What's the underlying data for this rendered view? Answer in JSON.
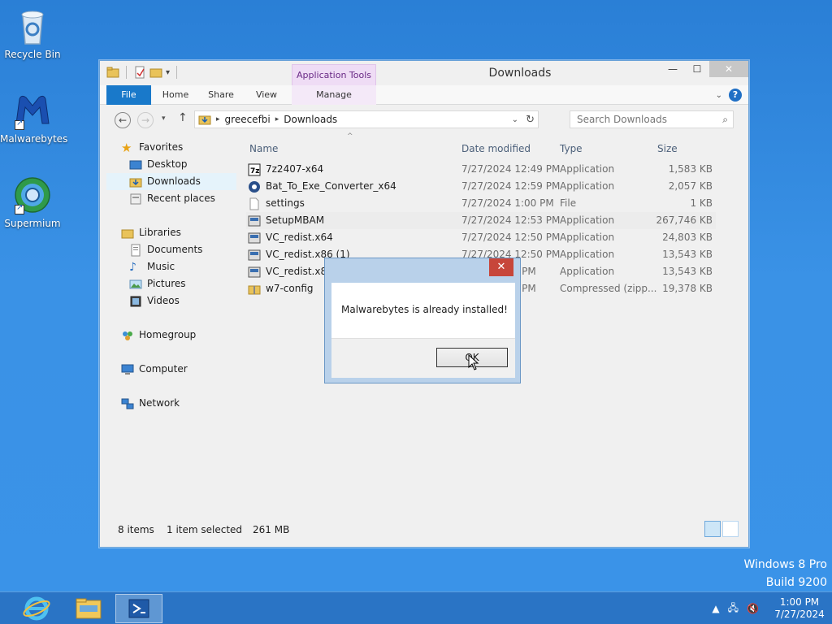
{
  "desktop": {
    "icons": [
      {
        "label": "Recycle Bin"
      },
      {
        "label": "Malwarebytes"
      },
      {
        "label": "Supermium"
      }
    ],
    "watermark": {
      "line1": "Windows 8 Pro",
      "line2": "Build 9200"
    }
  },
  "explorer": {
    "title": "Downloads",
    "context_tab_header": "Application Tools",
    "ribbon_tabs": {
      "file": "File",
      "home": "Home",
      "share": "Share",
      "view": "View",
      "manage": "Manage"
    },
    "address": {
      "crumbs": [
        "greecefbi",
        "Downloads"
      ]
    },
    "search_placeholder": "Search Downloads",
    "nav": {
      "favorites": "Favorites",
      "desktop": "Desktop",
      "downloads": "Downloads",
      "recent": "Recent places",
      "libraries": "Libraries",
      "documents": "Documents",
      "music": "Music",
      "pictures": "Pictures",
      "videos": "Videos",
      "homegroup": "Homegroup",
      "computer": "Computer",
      "network": "Network"
    },
    "columns": {
      "name": "Name",
      "date": "Date modified",
      "type": "Type",
      "size": "Size"
    },
    "files": [
      {
        "name": "7z2407-x64",
        "date": "7/27/2024 12:49 PM",
        "type": "Application",
        "size": "1,583 KB"
      },
      {
        "name": "Bat_To_Exe_Converter_x64",
        "date": "7/27/2024 12:59 PM",
        "type": "Application",
        "size": "2,057 KB"
      },
      {
        "name": "settings",
        "date": "7/27/2024 1:00 PM",
        "type": "File",
        "size": "1 KB"
      },
      {
        "name": "SetupMBAM",
        "date": "7/27/2024 12:53 PM",
        "type": "Application",
        "size": "267,746 KB"
      },
      {
        "name": "VC_redist.x64",
        "date": "7/27/2024 12:50 PM",
        "type": "Application",
        "size": "24,803 KB"
      },
      {
        "name": "VC_redist.x86 (1)",
        "date": "7/27/2024 12:50 PM",
        "type": "Application",
        "size": "13,543 KB"
      },
      {
        "name": "VC_redist.x86",
        "date": "50 PM",
        "type": "Application",
        "size": "13,543 KB"
      },
      {
        "name": "w7-config",
        "date": "50 PM",
        "type": "Compressed (zipp...",
        "size": "19,378 KB"
      }
    ],
    "status": {
      "items": "8 items",
      "selected": "1 item selected",
      "size": "261 MB"
    }
  },
  "dialog": {
    "message": "Malwarebytes is already installed!",
    "ok_label": "OK",
    "close_glyph": "✕"
  },
  "taskbar": {
    "clock_time": "1:00 PM",
    "clock_date": "7/27/2024"
  }
}
